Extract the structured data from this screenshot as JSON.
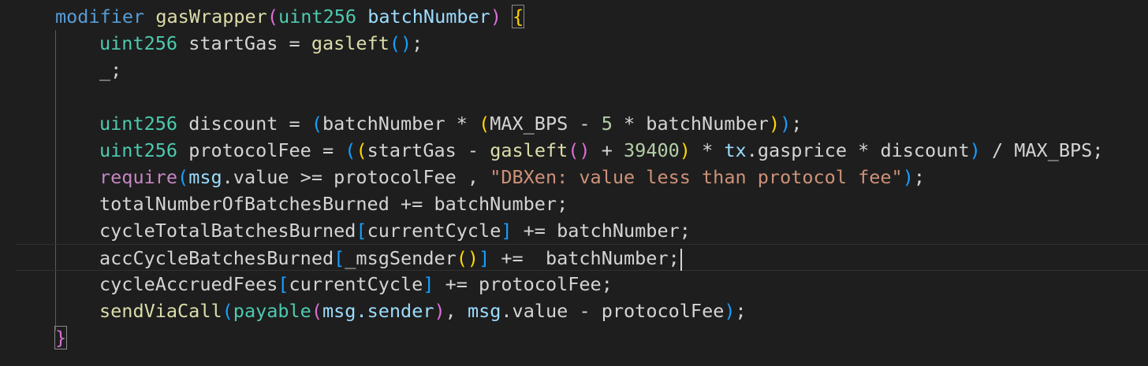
{
  "editor": {
    "lines": [
      {
        "tokens": [
          {
            "t": "modifier",
            "c": "kw"
          },
          {
            "t": " ",
            "c": "pl"
          },
          {
            "t": "gasWrapper",
            "c": "fn"
          },
          {
            "t": "(",
            "c": "b2"
          },
          {
            "t": "uint256",
            "c": "ty"
          },
          {
            "t": " ",
            "c": "pl"
          },
          {
            "t": "batchNumber",
            "c": "var"
          },
          {
            "t": ")",
            "c": "b2"
          },
          {
            "t": " ",
            "c": "pl"
          },
          {
            "t": "{",
            "c": "b1 bm"
          }
        ]
      },
      {
        "indent": 1,
        "tokens": [
          {
            "t": "uint256",
            "c": "ty"
          },
          {
            "t": " startGas = ",
            "c": "pl"
          },
          {
            "t": "gasleft",
            "c": "fn"
          },
          {
            "t": "()",
            "c": "b3"
          },
          {
            "t": ";",
            "c": "pl"
          }
        ]
      },
      {
        "indent": 1,
        "tokens": [
          {
            "t": "_;",
            "c": "pl"
          }
        ]
      },
      {
        "tokens": []
      },
      {
        "indent": 1,
        "tokens": [
          {
            "t": "uint256",
            "c": "ty"
          },
          {
            "t": " discount = ",
            "c": "pl"
          },
          {
            "t": "(",
            "c": "b3"
          },
          {
            "t": "batchNumber * ",
            "c": "pl"
          },
          {
            "t": "(",
            "c": "b1"
          },
          {
            "t": "MAX_BPS - ",
            "c": "pl"
          },
          {
            "t": "5",
            "c": "num"
          },
          {
            "t": " * batchNumber",
            "c": "pl"
          },
          {
            "t": ")",
            "c": "b1"
          },
          {
            "t": ")",
            "c": "b3"
          },
          {
            "t": ";",
            "c": "pl"
          }
        ]
      },
      {
        "indent": 1,
        "tokens": [
          {
            "t": "uint256",
            "c": "ty"
          },
          {
            "t": " protocolFee = ",
            "c": "pl"
          },
          {
            "t": "(",
            "c": "b3"
          },
          {
            "t": "(",
            "c": "b1"
          },
          {
            "t": "startGas - ",
            "c": "pl"
          },
          {
            "t": "gasleft",
            "c": "fn"
          },
          {
            "t": "()",
            "c": "b2"
          },
          {
            "t": " + ",
            "c": "pl"
          },
          {
            "t": "39400",
            "c": "num"
          },
          {
            "t": ")",
            "c": "b1"
          },
          {
            "t": " * ",
            "c": "pl"
          },
          {
            "t": "tx",
            "c": "var"
          },
          {
            "t": ".gasprice * discount",
            "c": "pl"
          },
          {
            "t": ")",
            "c": "b3"
          },
          {
            "t": " / MAX_BPS;",
            "c": "pl"
          }
        ]
      },
      {
        "indent": 1,
        "tokens": [
          {
            "t": "require",
            "c": "ctl"
          },
          {
            "t": "(",
            "c": "b3"
          },
          {
            "t": "msg",
            "c": "var"
          },
          {
            "t": ".value >= protocolFee , ",
            "c": "pl"
          },
          {
            "t": "\"DBXen: value less than protocol fee\"",
            "c": "str"
          },
          {
            "t": ")",
            "c": "b3"
          },
          {
            "t": ";",
            "c": "pl"
          }
        ]
      },
      {
        "indent": 1,
        "tokens": [
          {
            "t": "totalNumberOfBatchesBurned += batchNumber;",
            "c": "pl"
          }
        ]
      },
      {
        "indent": 1,
        "tokens": [
          {
            "t": "cycleTotalBatchesBurned",
            "c": "pl"
          },
          {
            "t": "[",
            "c": "b3"
          },
          {
            "t": "currentCycle",
            "c": "pl"
          },
          {
            "t": "]",
            "c": "b3"
          },
          {
            "t": " += batchNumber;",
            "c": "pl"
          }
        ]
      },
      {
        "indent": 1,
        "current": true,
        "tokens": [
          {
            "t": "accCycleBatchesBurned",
            "c": "pl"
          },
          {
            "t": "[",
            "c": "b3"
          },
          {
            "t": "_msgSender",
            "c": "pl"
          },
          {
            "t": "()",
            "c": "b1"
          },
          {
            "t": "]",
            "c": "b3"
          },
          {
            "t": " +=  batchNumber;",
            "c": "pl"
          }
        ]
      },
      {
        "indent": 1,
        "tokens": [
          {
            "t": "cycleAccruedFees",
            "c": "pl"
          },
          {
            "t": "[",
            "c": "b3"
          },
          {
            "t": "currentCycle",
            "c": "pl"
          },
          {
            "t": "]",
            "c": "b3"
          },
          {
            "t": " += protocolFee;",
            "c": "pl"
          }
        ]
      },
      {
        "indent": 1,
        "tokens": [
          {
            "t": "sendViaCall",
            "c": "fn"
          },
          {
            "t": "(",
            "c": "b3"
          },
          {
            "t": "payable",
            "c": "ty"
          },
          {
            "t": "(",
            "c": "b2"
          },
          {
            "t": "msg",
            "c": "var"
          },
          {
            "t": ".sender",
            "c": "var"
          },
          {
            "t": ")",
            "c": "b2"
          },
          {
            "t": ", ",
            "c": "pl"
          },
          {
            "t": "msg",
            "c": "var"
          },
          {
            "t": ".value - protocolFee",
            "c": "pl"
          },
          {
            "t": ")",
            "c": "b3"
          },
          {
            "t": ";",
            "c": "pl"
          }
        ]
      },
      {
        "tokens": [
          {
            "t": "}",
            "c": "b2 bm"
          }
        ]
      }
    ]
  }
}
